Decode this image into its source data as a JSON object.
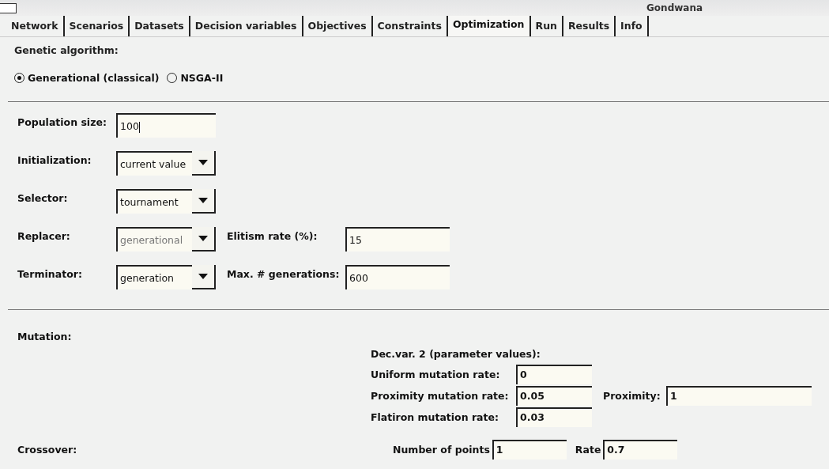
{
  "window": {
    "title": "Gondwana"
  },
  "tabs": [
    {
      "label": "Network",
      "selected": false
    },
    {
      "label": "Scenarios",
      "selected": false
    },
    {
      "label": "Datasets",
      "selected": false
    },
    {
      "label": "Decision variables",
      "selected": false
    },
    {
      "label": "Objectives",
      "selected": false
    },
    {
      "label": "Constraints",
      "selected": false
    },
    {
      "label": "Optimization",
      "selected": true
    },
    {
      "label": "Run",
      "selected": false
    },
    {
      "label": "Results",
      "selected": false
    },
    {
      "label": "Info",
      "selected": false
    }
  ],
  "algorithm": {
    "label": "Genetic algorithm:",
    "options": [
      {
        "label": "Generational (classical)",
        "selected": true
      },
      {
        "label": "NSGA-II",
        "selected": false
      }
    ]
  },
  "parameters": [
    {
      "label": "Population size:",
      "kind": "text",
      "value": "100"
    },
    {
      "label": "Initialization:",
      "kind": "combo",
      "value": "current value",
      "disabled": false
    },
    {
      "label": "Selector:",
      "kind": "combo",
      "value": "tournament",
      "disabled": false
    },
    {
      "label": "Replacer:",
      "kind": "combo",
      "value": "generational",
      "disabled": true,
      "extra": {
        "label": "Elitism rate (%):",
        "value": "15"
      }
    },
    {
      "label": "Terminator:",
      "kind": "combo",
      "value": "generation",
      "disabled": false,
      "extra": {
        "label": "Max. # generations:",
        "value": "600"
      }
    }
  ],
  "mutation": {
    "label": "Mutation:",
    "heading": "Dec.var. 2 (parameter values):",
    "rows": [
      {
        "label": "Uniform mutation rate:",
        "value": "0"
      },
      {
        "label": "Proximity mutation rate:",
        "value": "0.05",
        "extra": {
          "label": "Proximity:",
          "value": "1"
        }
      },
      {
        "label": "Flatiron mutation rate:",
        "value": "0.03"
      }
    ]
  },
  "crossover": {
    "label": "Crossover:",
    "points_label": "Number of points",
    "points": "1",
    "rate_label": "Rate",
    "rate": "0.7"
  }
}
